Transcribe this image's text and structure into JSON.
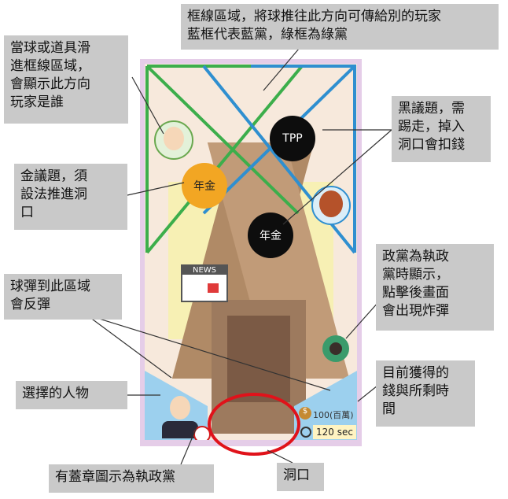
{
  "callouts": {
    "frame_zone": "框線區域，將球推往此方向可傳給別的玩家\n藍框代表藍黨，綠框為綠黨",
    "slide_in": "當球或道具滑\n進框線區域，\n會顯示此方向\n玩家是誰",
    "black_issue": "黑議題，需\n踢走，掉入\n洞口會扣錢",
    "gold_issue": "金議題，須\n設法推進洞\n口",
    "ruling_party": "政黨為執政\n黨時顯示，\n點擊後畫面\n會出現炸彈",
    "bounce": "球彈到此區域\n會反彈",
    "money_time": "目前獲得的\n錢與所剩時\n間",
    "chosen": "選擇的人物",
    "badge": "有蓋章圖示為執政黨",
    "hole": "洞口"
  },
  "game": {
    "ball_tpp": "TPP",
    "ball_pension_black": "年金",
    "ball_pension_gold": "年金",
    "news": "NEWS",
    "money": "100(百萬)",
    "money_icon": "$",
    "timer": "120 sec"
  },
  "colors": {
    "green": "#3cae4b",
    "blue": "#2f8fd0",
    "red": "#e0121a",
    "bouncer": "#9cd0ee"
  }
}
